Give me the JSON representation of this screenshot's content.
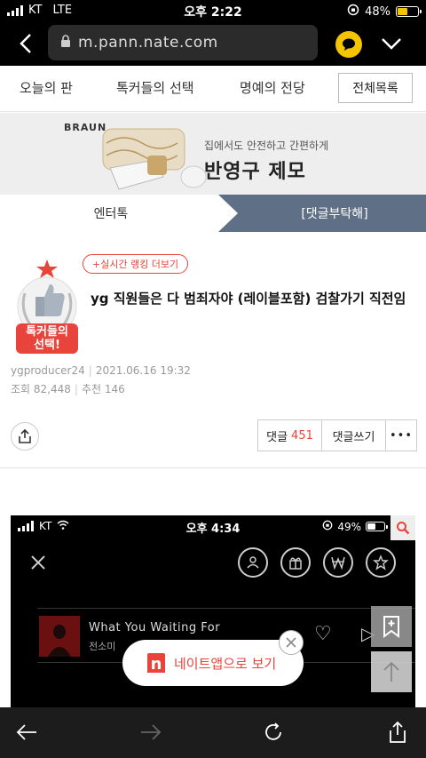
{
  "status": {
    "carrier": "KT",
    "network": "LTE",
    "time": "오후 2:22",
    "battery": "48%"
  },
  "browser": {
    "url": "m.pann.nate.com"
  },
  "nav": {
    "tabs": [
      "오늘의 판",
      "톡커들의 선택",
      "명예의 전당"
    ],
    "all_button": "전체목록"
  },
  "ad": {
    "brand": "BRAUN",
    "line1": "집에서도 안전하고 간편하게",
    "line2": "반영구 제모"
  },
  "category": {
    "left": "엔터톡",
    "right": "[댓글부탁해]"
  },
  "article": {
    "badge_text": "톡커들의 선택!",
    "live_rank_label": "+실시간 랭킹 더보기",
    "title": "yg 직원들은 다 범죄자야 (레이블포함) 검찰가기 직전임",
    "author": "ygproducer24",
    "date": "2021.06.16 19:32",
    "views_label": "조회",
    "views": "82,448",
    "recommend_label": "추천",
    "recommend": "146"
  },
  "actions": {
    "comment_label": "댓글",
    "comment_count": "451",
    "write_label": "댓글쓰기",
    "more": "•••"
  },
  "embed": {
    "carrier": "KT",
    "time": "오후 4:34",
    "battery": "49%",
    "song": "What You Waiting For",
    "artist": "전소미"
  },
  "app_banner": {
    "text": "네이트앱으로 보기",
    "logo": "n"
  },
  "colors": {
    "accent": "#e8443c",
    "category_bg": "#5f6f86",
    "talk_yellow": "#f5c400"
  }
}
